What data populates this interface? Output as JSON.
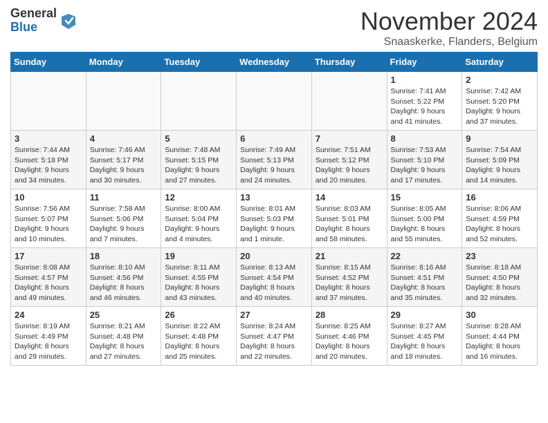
{
  "logo": {
    "general": "General",
    "blue": "Blue"
  },
  "header": {
    "title": "November 2024",
    "subtitle": "Snaaskerke, Flanders, Belgium"
  },
  "weekdays": [
    "Sunday",
    "Monday",
    "Tuesday",
    "Wednesday",
    "Thursday",
    "Friday",
    "Saturday"
  ],
  "weeks": [
    [
      {
        "day": "",
        "info": ""
      },
      {
        "day": "",
        "info": ""
      },
      {
        "day": "",
        "info": ""
      },
      {
        "day": "",
        "info": ""
      },
      {
        "day": "",
        "info": ""
      },
      {
        "day": "1",
        "info": "Sunrise: 7:41 AM\nSunset: 5:22 PM\nDaylight: 9 hours and 41 minutes."
      },
      {
        "day": "2",
        "info": "Sunrise: 7:42 AM\nSunset: 5:20 PM\nDaylight: 9 hours and 37 minutes."
      }
    ],
    [
      {
        "day": "3",
        "info": "Sunrise: 7:44 AM\nSunset: 5:18 PM\nDaylight: 9 hours and 34 minutes."
      },
      {
        "day": "4",
        "info": "Sunrise: 7:46 AM\nSunset: 5:17 PM\nDaylight: 9 hours and 30 minutes."
      },
      {
        "day": "5",
        "info": "Sunrise: 7:48 AM\nSunset: 5:15 PM\nDaylight: 9 hours and 27 minutes."
      },
      {
        "day": "6",
        "info": "Sunrise: 7:49 AM\nSunset: 5:13 PM\nDaylight: 9 hours and 24 minutes."
      },
      {
        "day": "7",
        "info": "Sunrise: 7:51 AM\nSunset: 5:12 PM\nDaylight: 9 hours and 20 minutes."
      },
      {
        "day": "8",
        "info": "Sunrise: 7:53 AM\nSunset: 5:10 PM\nDaylight: 9 hours and 17 minutes."
      },
      {
        "day": "9",
        "info": "Sunrise: 7:54 AM\nSunset: 5:09 PM\nDaylight: 9 hours and 14 minutes."
      }
    ],
    [
      {
        "day": "10",
        "info": "Sunrise: 7:56 AM\nSunset: 5:07 PM\nDaylight: 9 hours and 10 minutes."
      },
      {
        "day": "11",
        "info": "Sunrise: 7:58 AM\nSunset: 5:06 PM\nDaylight: 9 hours and 7 minutes."
      },
      {
        "day": "12",
        "info": "Sunrise: 8:00 AM\nSunset: 5:04 PM\nDaylight: 9 hours and 4 minutes."
      },
      {
        "day": "13",
        "info": "Sunrise: 8:01 AM\nSunset: 5:03 PM\nDaylight: 9 hours and 1 minute."
      },
      {
        "day": "14",
        "info": "Sunrise: 8:03 AM\nSunset: 5:01 PM\nDaylight: 8 hours and 58 minutes."
      },
      {
        "day": "15",
        "info": "Sunrise: 8:05 AM\nSunset: 5:00 PM\nDaylight: 8 hours and 55 minutes."
      },
      {
        "day": "16",
        "info": "Sunrise: 8:06 AM\nSunset: 4:59 PM\nDaylight: 8 hours and 52 minutes."
      }
    ],
    [
      {
        "day": "17",
        "info": "Sunrise: 8:08 AM\nSunset: 4:57 PM\nDaylight: 8 hours and 49 minutes."
      },
      {
        "day": "18",
        "info": "Sunrise: 8:10 AM\nSunset: 4:56 PM\nDaylight: 8 hours and 46 minutes."
      },
      {
        "day": "19",
        "info": "Sunrise: 8:11 AM\nSunset: 4:55 PM\nDaylight: 8 hours and 43 minutes."
      },
      {
        "day": "20",
        "info": "Sunrise: 8:13 AM\nSunset: 4:54 PM\nDaylight: 8 hours and 40 minutes."
      },
      {
        "day": "21",
        "info": "Sunrise: 8:15 AM\nSunset: 4:52 PM\nDaylight: 8 hours and 37 minutes."
      },
      {
        "day": "22",
        "info": "Sunrise: 8:16 AM\nSunset: 4:51 PM\nDaylight: 8 hours and 35 minutes."
      },
      {
        "day": "23",
        "info": "Sunrise: 8:18 AM\nSunset: 4:50 PM\nDaylight: 8 hours and 32 minutes."
      }
    ],
    [
      {
        "day": "24",
        "info": "Sunrise: 8:19 AM\nSunset: 4:49 PM\nDaylight: 8 hours and 29 minutes."
      },
      {
        "day": "25",
        "info": "Sunrise: 8:21 AM\nSunset: 4:48 PM\nDaylight: 8 hours and 27 minutes."
      },
      {
        "day": "26",
        "info": "Sunrise: 8:22 AM\nSunset: 4:48 PM\nDaylight: 8 hours and 25 minutes."
      },
      {
        "day": "27",
        "info": "Sunrise: 8:24 AM\nSunset: 4:47 PM\nDaylight: 8 hours and 22 minutes."
      },
      {
        "day": "28",
        "info": "Sunrise: 8:25 AM\nSunset: 4:46 PM\nDaylight: 8 hours and 20 minutes."
      },
      {
        "day": "29",
        "info": "Sunrise: 8:27 AM\nSunset: 4:45 PM\nDaylight: 8 hours and 18 minutes."
      },
      {
        "day": "30",
        "info": "Sunrise: 8:28 AM\nSunset: 4:44 PM\nDaylight: 8 hours and 16 minutes."
      }
    ]
  ]
}
